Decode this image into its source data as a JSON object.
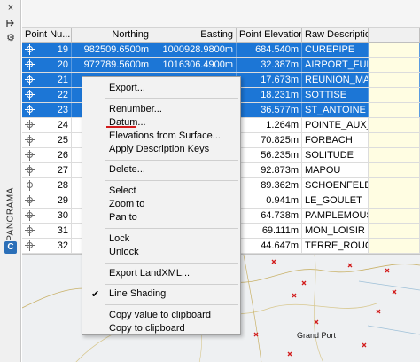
{
  "table": {
    "columns": [
      "Point Nu...",
      "Northing",
      "Easting",
      "Point Elevation",
      "Raw Description",
      ""
    ],
    "rows": [
      {
        "num": "19",
        "northing": "982509.6500m",
        "easting": "1000928.9800m",
        "elev": "684.540m",
        "desc": "CUREPIPE",
        "selected": true
      },
      {
        "num": "20",
        "northing": "972789.5600m",
        "easting": "1016306.4900m",
        "elev": "32.387m",
        "desc": "AIRPORT_FUEL_",
        "selected": true
      },
      {
        "num": "21",
        "northing": "",
        "easting": "",
        "elev": "17.673m",
        "desc": "REUNION_MAU",
        "selected": true
      },
      {
        "num": "22",
        "northing": "",
        "easting": "",
        "elev": "18.231m",
        "desc": "SOTTISE",
        "selected": true
      },
      {
        "num": "23",
        "northing": "",
        "easting": "",
        "elev": "36.577m",
        "desc": "ST_ANTOINE",
        "selected": true
      },
      {
        "num": "24",
        "northing": "",
        "easting": "",
        "elev": "1.264m",
        "desc": "POINTE_AUX_BI",
        "selected": false
      },
      {
        "num": "25",
        "northing": "",
        "easting": "",
        "elev": "70.825m",
        "desc": "FORBACH",
        "selected": false
      },
      {
        "num": "26",
        "northing": "",
        "easting": "",
        "elev": "56.235m",
        "desc": "SOLITUDE",
        "selected": false
      },
      {
        "num": "27",
        "northing": "",
        "easting": "",
        "elev": "92.873m",
        "desc": "MAPOU",
        "selected": false
      },
      {
        "num": "28",
        "northing": "",
        "easting": "",
        "elev": "89.362m",
        "desc": "SCHOENFELD",
        "selected": false
      },
      {
        "num": "29",
        "northing": "",
        "easting": "",
        "elev": "0.941m",
        "desc": "LE_GOULET",
        "selected": false
      },
      {
        "num": "30",
        "northing": "",
        "easting": "",
        "elev": "64.738m",
        "desc": "PAMPLEMOUSS",
        "selected": false
      },
      {
        "num": "31",
        "northing": "",
        "easting": "",
        "elev": "69.111m",
        "desc": "MON_LOISIR",
        "selected": false
      },
      {
        "num": "32",
        "northing": "",
        "easting": "",
        "elev": "44.647m",
        "desc": "TERRE_ROUGE",
        "selected": false
      }
    ]
  },
  "side": {
    "label": "PANORAMA",
    "close_icon": "×",
    "pin_icon": "pin",
    "gear_icon": "⚙",
    "app_icon": "C"
  },
  "menu": {
    "export": "Export...",
    "renumber": "Renumber...",
    "datum": "Datum...",
    "elevations": "Elevations from Surface...",
    "apply_keys": "Apply Description Keys",
    "delete": "Delete...",
    "select": "Select",
    "zoom_to": "Zoom to",
    "pan_to": "Pan to",
    "lock": "Lock",
    "unlock": "Unlock",
    "export_landxml": "Export LandXML...",
    "line_shading": "Line Shading",
    "line_shading_checked": true,
    "copy_value": "Copy value to clipboard",
    "copy_to": "Copy to clipboard"
  },
  "map": {
    "label": "Grand Port"
  },
  "colors": {
    "selection": "#1c76d6",
    "menu_bg": "#f2f2f2",
    "highlight_col": "#fffde2",
    "marker": "#d21c1c"
  }
}
